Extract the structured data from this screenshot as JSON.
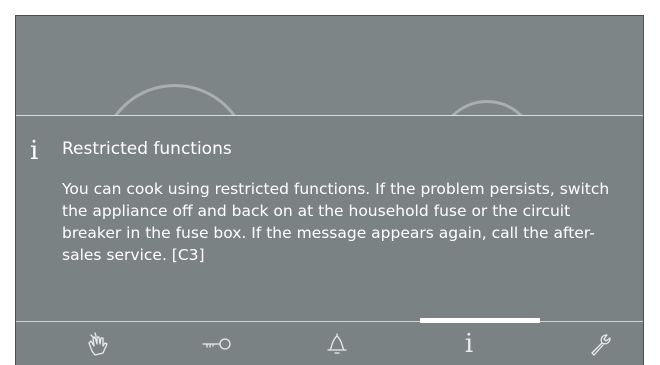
{
  "message": {
    "icon": "info-icon",
    "icon_glyph": "i",
    "title": "Restricted functions",
    "body": "You can cook using restricted functions. If the problem persists, switch the appliance off and back on at the household fuse  or the circuit breaker in the fuse box.  If the message appears again, call the after-sales service. [C3]"
  },
  "tabs": [
    {
      "icon": "hand-gesture-icon",
      "active": false
    },
    {
      "icon": "key-icon",
      "active": false
    },
    {
      "icon": "bell-icon",
      "active": false
    },
    {
      "icon": "info-icon",
      "glyph": "i",
      "active": true
    },
    {
      "icon": "wrench-icon",
      "active": false
    }
  ],
  "colors": {
    "screen": "#7d8587",
    "overlay": "#7b8284",
    "text": "#ffffff",
    "icon": "#e8ebec"
  }
}
